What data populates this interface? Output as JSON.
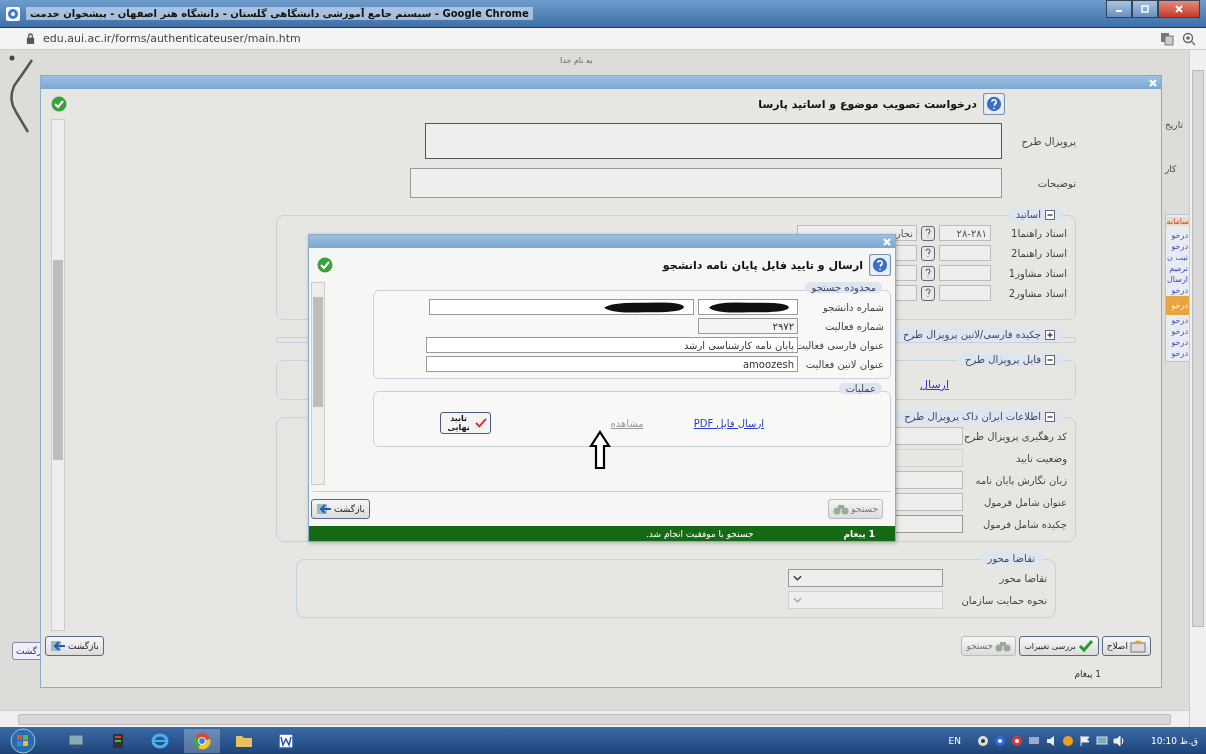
{
  "window": {
    "title": "سیستم جامع آموزشی دانشگاهی گلستان - دانشگاه هنر اصفهان - پیشخوان خدمت - Google Chrome"
  },
  "address_bar": {
    "url": "edu.aui.ac.ir/forms/authenticateuser/main.htm"
  },
  "page": {
    "greeting": "به نام خدا",
    "side_labels": [
      "تاریخ",
      "کار"
    ],
    "menu_title": "سامانه",
    "menu_items": [
      {
        "label": "درخو",
        "selected": false
      },
      {
        "label": "درخو",
        "selected": false
      },
      {
        "label": "ثبت ن",
        "selected": false
      },
      {
        "label": "ترمیم",
        "selected": false
      },
      {
        "label": "ارسال",
        "selected": false
      },
      {
        "label": "درخو",
        "selected": false
      },
      {
        "label": "درخو",
        "selected": true
      },
      {
        "label": "درخو",
        "selected": false
      },
      {
        "label": "درخو",
        "selected": false
      },
      {
        "label": "درخو",
        "selected": false
      },
      {
        "label": "درخو",
        "selected": false
      }
    ],
    "back_button": "رگشت"
  },
  "main_dialog": {
    "title": "درخواست تصویب موضوع و اساتید پارسا",
    "fields": [
      {
        "label": "پروپزال طرح",
        "kind": "tall"
      },
      {
        "label": "توضیحات",
        "kind": "short"
      }
    ],
    "sections": [
      {
        "title": "اساتید",
        "expanded": true,
        "kind": "professors",
        "rows": [
          {
            "label": "استاد راهنما1",
            "code": "۲۸-۲۸۱",
            "name": "نجار"
          },
          {
            "label": "استاد راهنما2"
          },
          {
            "label": "استاد مشاور1"
          },
          {
            "label": "استاد مشاور2"
          }
        ]
      },
      {
        "title": "چکیده فارسی/لاتین پروپزال طرح",
        "expanded": false,
        "kind": "empty"
      },
      {
        "title": "فایل پروپزال طرح",
        "expanded": true,
        "kind": "link",
        "link": "ارسال"
      },
      {
        "title": "اطلاعات ایران داک پروپزال طرح",
        "expanded": true,
        "kind": "fields",
        "rows": [
          {
            "label": "کد رهگیری پروپزال طرح",
            "kind": "text"
          },
          {
            "label": "وضعیت تایید",
            "kind": "readonly"
          },
          {
            "label": "زبان نگارش پایان نامه",
            "kind": "text"
          },
          {
            "label": "عنوان شامل فرمول",
            "kind": "text"
          },
          {
            "label": "چکیده شامل فرمول",
            "kind": "select",
            "disabled": false
          }
        ]
      },
      {
        "title": "تقاضا محور",
        "kind": "fields",
        "rows": [
          {
            "label": "تقاضا محور",
            "kind": "select",
            "disabled": false
          },
          {
            "label": "نحوه حمایت سازمان",
            "kind": "select",
            "disabled": true
          }
        ]
      }
    ],
    "buttons": [
      {
        "label": "اصلاح",
        "kind": "edit",
        "disabled": false
      },
      {
        "label": "بررسی تغییرات",
        "kind": "review",
        "disabled": false
      },
      {
        "label": "جستجو",
        "kind": "search",
        "disabled": true
      }
    ],
    "back_button": "بازگشت",
    "status": "1 پیغام"
  },
  "file_dialog": {
    "title": "ارسال و تایید فایل پایان نامه دانشجو",
    "search_section": {
      "title": "محدوده جستجو",
      "fields": [
        {
          "label": "شماره دانشجو",
          "kind": "redacted"
        },
        {
          "label": "شماره فعالیت",
          "kind": "short",
          "value": "۲۹۷۲"
        },
        {
          "label": "عنوان فارسی فعالیت",
          "kind": "long",
          "value": "پایان نامه کارشناسی ارشد"
        },
        {
          "label": "عنوان لاتین فعالیت",
          "kind": "long",
          "value": "amoozesh"
        }
      ]
    },
    "operations": {
      "title": "عملیات",
      "items": [
        {
          "label": "ارسال فایل PDF",
          "kind": "link",
          "disabled": false
        },
        {
          "label": "مشاهده",
          "kind": "link",
          "disabled": true
        },
        {
          "label": "تایید نهایی",
          "kind": "button",
          "disabled": false
        }
      ]
    },
    "search_button": {
      "label": "جستجو",
      "disabled": true
    },
    "back_button": "بازگشت",
    "status": {
      "count": "1 پیغام",
      "message": "جستجو با موفقیت انجام شد."
    }
  },
  "taskbar": {
    "language": "EN",
    "clock": "10:10 ق.ظ"
  }
}
